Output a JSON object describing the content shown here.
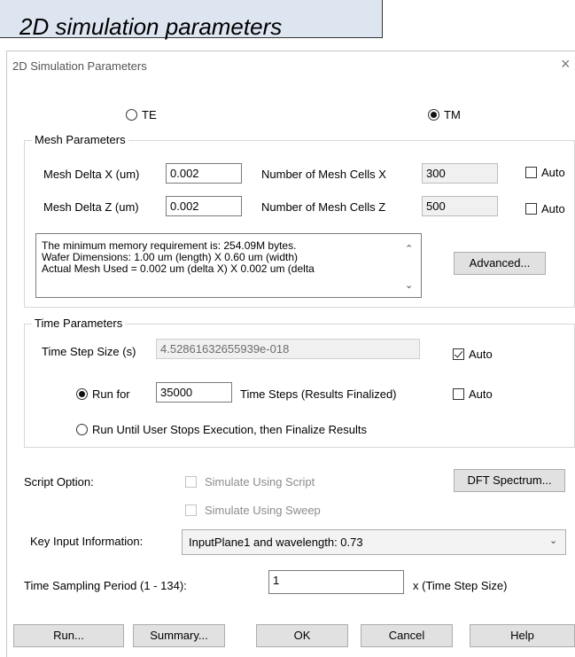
{
  "caption": "2D simulation parameters",
  "dialog": {
    "title": "2D Simulation Parameters",
    "close_glyph": "×"
  },
  "polarization": {
    "te_label": "TE",
    "tm_label": "TM",
    "selected": "TM"
  },
  "mesh": {
    "group_label": "Mesh Parameters",
    "delta_x_label": "Mesh Delta X (um)",
    "delta_x_value": "0.002",
    "delta_z_label": "Mesh Delta Z (um)",
    "delta_z_value": "0.002",
    "cells_x_label": "Number of Mesh Cells X",
    "cells_x_value": "300",
    "cells_z_label": "Number of Mesh Cells Z",
    "cells_z_value": "500",
    "auto_label": "Auto",
    "auto_x_checked": false,
    "auto_z_checked": false,
    "info_lines": [
      "The minimum memory requirement is: 254.09M bytes.",
      "Wafer Dimensions: 1.00 um (length) X 0.60 um (width)",
      "Actual Mesh Used = 0.002 um (delta X) X 0.002 um (delta"
    ],
    "advanced_button": "Advanced..."
  },
  "time": {
    "group_label": "Time Parameters",
    "step_size_label": "Time Step Size (s)",
    "step_size_value": "4.52861632655939e-018",
    "auto_label": "Auto",
    "auto_step_checked": true,
    "run_for_label": "Run for",
    "run_for_value": "35000",
    "run_for_suffix": "Time Steps (Results Finalized)",
    "auto_run_checked": false,
    "run_until_label": "Run Until User Stops Execution, then Finalize Results",
    "selected_run_mode": "run_for"
  },
  "script": {
    "option_label": "Script Option:",
    "simulate_script": "Simulate Using Script",
    "simulate_sweep": "Simulate Using Sweep",
    "dft_button": "DFT Spectrum..."
  },
  "key_input": {
    "label": "Key Input Information:",
    "selected": "InputPlane1 and wavelength: 0.73"
  },
  "sampling": {
    "label": "Time Sampling Period (1 - 134):",
    "value": "1",
    "suffix": "x (Time Step Size)"
  },
  "buttons": {
    "run": "Run...",
    "summary": "Summary...",
    "ok": "OK",
    "cancel": "Cancel",
    "help": "Help"
  }
}
